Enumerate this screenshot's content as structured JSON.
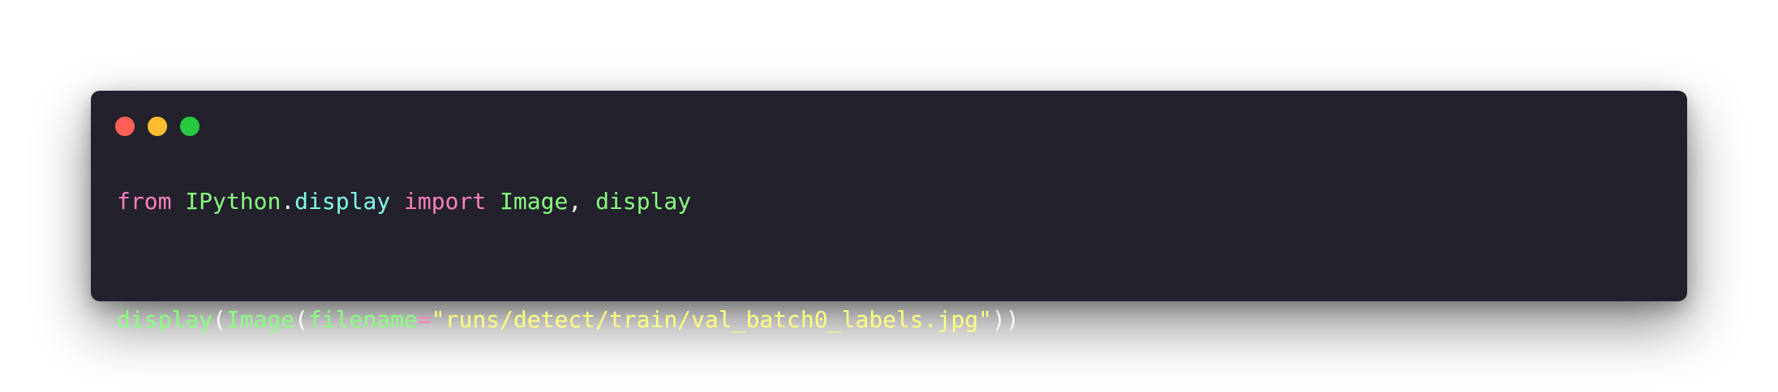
{
  "window_controls": {
    "close_color": "#ff5f57",
    "minimize_color": "#febc2e",
    "maximize_color": "#28c840",
    "icons": [
      "close-dot-icon",
      "minimize-dot-icon",
      "maximize-dot-icon"
    ]
  },
  "theme": {
    "background": "#22212c",
    "keyword": "#ff80bf",
    "name": "#8aff80",
    "attribute": "#80ffea",
    "string": "#ffff80",
    "punctuation": "#f8f8f2"
  },
  "code": {
    "line1": {
      "kw_from": "from",
      "module": "IPython",
      "dot": ".",
      "submodule": "display",
      "kw_import": "import",
      "name1": "Image",
      "comma": ",",
      "name2": "display"
    },
    "line2": {
      "func": "display",
      "paren_open": "(",
      "cls": "Image",
      "paren_open2": "(",
      "kwarg": "filename",
      "equals": "=",
      "string": "\"runs/detect/train/val_batch0_labels.jpg\"",
      "paren_close": "))"
    }
  }
}
